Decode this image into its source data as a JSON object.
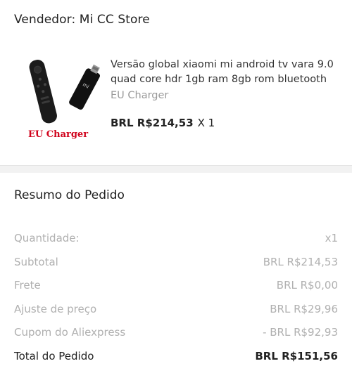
{
  "seller": {
    "label": "Vendedor: Mi CC Store"
  },
  "product": {
    "image_icon": "tv-stick-product-image",
    "image_caption": "EU Charger",
    "title": "Versão global xiaomi mi android tv vara 9.0 quad core hdr 1gb ram 8gb rom bluetooth",
    "variant": "EU Charger",
    "price": "BRL R$214,53",
    "quantity": "X 1"
  },
  "summary": {
    "title": "Resumo do Pedido",
    "rows": [
      {
        "label": "Quantidade:",
        "value": "x1"
      },
      {
        "label": "Subtotal",
        "value": "BRL R$214,53"
      },
      {
        "label": "Frete",
        "value": "BRL R$0,00"
      },
      {
        "label": "Ajuste de preço",
        "value": "BRL R$29,96"
      },
      {
        "label": "Cupom do Aliexpress",
        "value": "- BRL R$92,93"
      }
    ],
    "total": {
      "label": "Total do Pedido",
      "value": "BRL R$151,56"
    }
  },
  "colors": {
    "caption_red": "#d0021b",
    "muted_text": "#b0b0b0",
    "divider": "#f2f2f2"
  }
}
